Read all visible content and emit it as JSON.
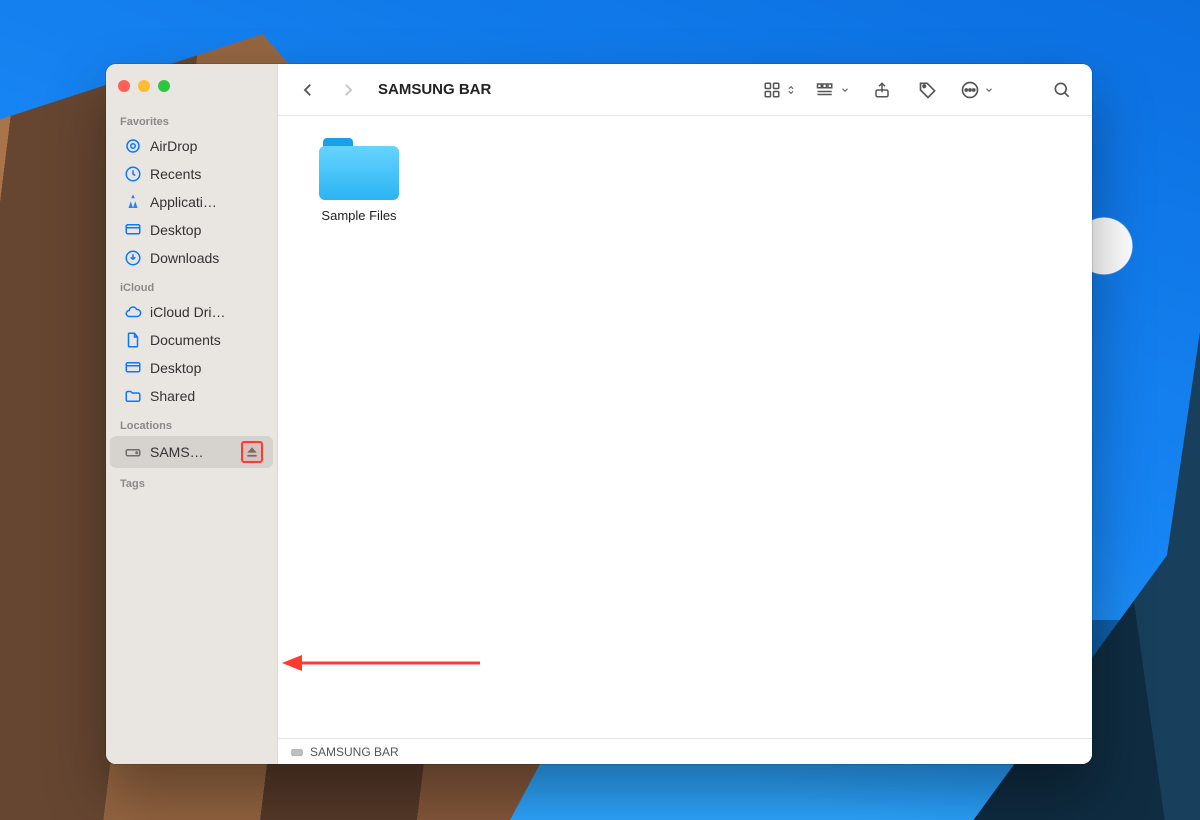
{
  "window_title": "SAMSUNG BAR",
  "sidebar": {
    "sections": [
      {
        "label": "Favorites",
        "items": [
          {
            "icon": "airdrop",
            "label": "AirDrop"
          },
          {
            "icon": "clock",
            "label": "Recents"
          },
          {
            "icon": "appgrid",
            "label": "Applicati…"
          },
          {
            "icon": "desktop",
            "label": "Desktop"
          },
          {
            "icon": "download",
            "label": "Downloads"
          }
        ]
      },
      {
        "label": "iCloud",
        "items": [
          {
            "icon": "cloud",
            "label": "iCloud Dri…"
          },
          {
            "icon": "doc",
            "label": "Documents"
          },
          {
            "icon": "desktop",
            "label": "Desktop"
          },
          {
            "icon": "folder",
            "label": "Shared"
          }
        ]
      },
      {
        "label": "Locations",
        "items": [
          {
            "icon": "disk",
            "label": "SAMS…",
            "eject": true,
            "selected": true
          }
        ]
      },
      {
        "label": "Tags",
        "items": []
      }
    ]
  },
  "content": {
    "items": [
      {
        "type": "folder",
        "label": "Sample Files"
      }
    ]
  },
  "pathbar": {
    "segments": [
      {
        "icon": "disk",
        "label": "SAMSUNG BAR"
      }
    ]
  },
  "annotation": {
    "target": "eject-button",
    "color": "#ff3b30"
  }
}
